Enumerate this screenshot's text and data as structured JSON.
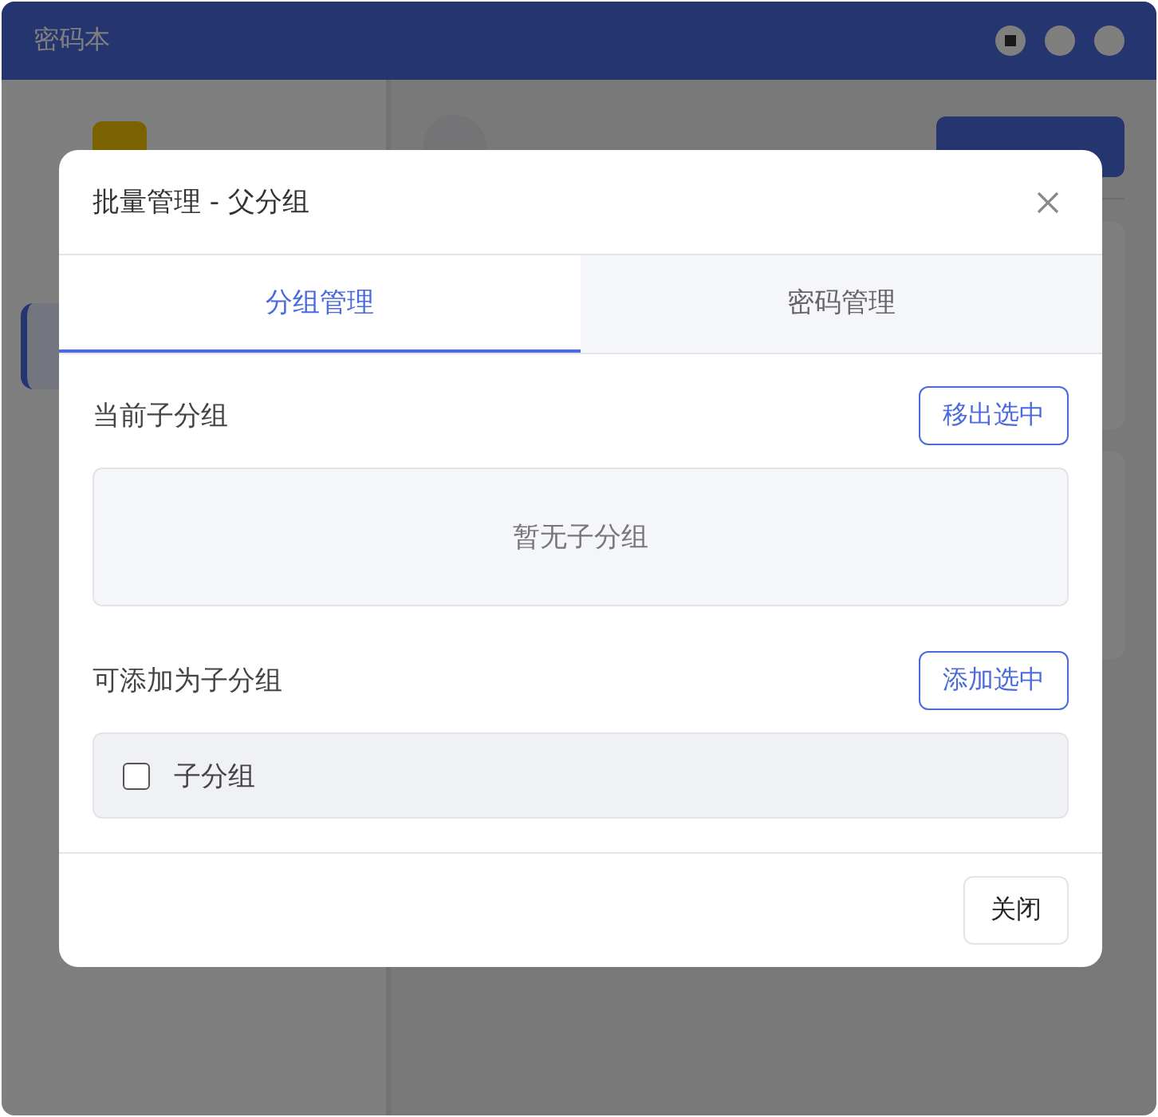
{
  "window": {
    "title": "密码本"
  },
  "dialog": {
    "title": "批量管理 - 父分组",
    "tabs": [
      {
        "label": "分组管理",
        "selected": true
      },
      {
        "label": "密码管理",
        "selected": false
      }
    ],
    "sections": [
      {
        "label": "当前子分组",
        "action": "移出选中",
        "empty_text": "暂无子分组"
      },
      {
        "label": "可添加为子分组",
        "action": "添加选中",
        "items": [
          {
            "label": "子分组",
            "checked": false
          }
        ]
      }
    ],
    "footer_buttons": [
      "关闭"
    ]
  }
}
